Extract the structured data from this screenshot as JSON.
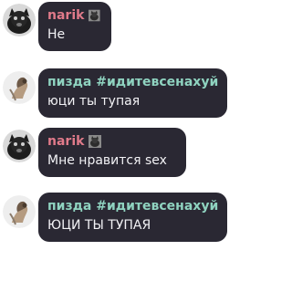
{
  "messages": [
    {
      "author": "narik",
      "text": "Не",
      "name_color": "#e07a8a"
    },
    {
      "author": "пизда #идитевсенахуй",
      "text": "юци ты тупая",
      "name_color": "#8fd3c0"
    },
    {
      "author": "narik",
      "text": "Мне нравится sex",
      "name_color": "#e07a8a"
    },
    {
      "author": "пизда #идитевсенахуй",
      "text": "ЮЦИ ТЫ ТУПАЯ",
      "name_color": "#8fd3c0"
    }
  ],
  "colors": {
    "bubble_bg": "#2a2833",
    "text": "#f2f2f5"
  },
  "icons": {
    "narik_badge": "cat-photo-badge-icon",
    "pizda_badge": "tree-badge-icon"
  }
}
